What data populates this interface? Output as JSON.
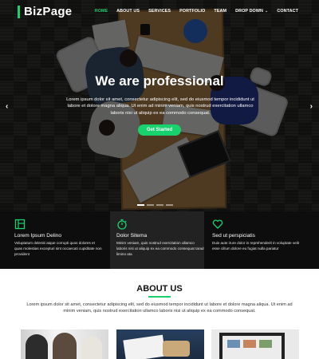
{
  "brand": "BizPage",
  "nav": [
    {
      "label": "HOME",
      "active": true
    },
    {
      "label": "ABOUT US"
    },
    {
      "label": "SERVICES"
    },
    {
      "label": "PORTFOLIO"
    },
    {
      "label": "TEAM"
    },
    {
      "label": "DROP DOWN"
    },
    {
      "label": "CONTACT"
    }
  ],
  "hero": {
    "title": "We are professional",
    "text": "Lorem ipsum dolor sit amet, consectetur adipiscing elit, sed do eiusmod tempor incididunt ut labore et dolore magna aliqua. Ut enim ad minim veniam, quis nostrud exercitation ullamco laboris nisi ut aliquip ex ea commodo consequat.",
    "button": "Get Started",
    "arrow_left": "‹",
    "arrow_right": "›",
    "slides": 4,
    "active_slide": 1
  },
  "features": [
    {
      "icon": "document-icon",
      "title": "Lorem Ipsum Delino",
      "text": "Voluptatum deleniti atque corrupti quos dolores et quas molestias excepturi sint occaecati cupiditate non provident"
    },
    {
      "icon": "stopwatch-icon",
      "title": "Dolor Sitema",
      "text": "Minim veniam, quis nostrud exercitation ullamco laboris nisi ut aliquip ex ea commodo consequat tarad limino ata"
    },
    {
      "icon": "heart-icon",
      "title": "Sed ut perspiciatis",
      "text": "Duis aute irure dolor in reprehenderit in voluptate velit esse cillum dolore eu fugiat nulla pariatur"
    }
  ],
  "about": {
    "title": "ABOUT US",
    "text": "Lorem ipsum dolor sit amet, consectetur adipiscing elit, sed do eiusmod tempor incididunt ut labore et dolore magna aliqua. Ut enim ad minim veniam, quis nostrud exercitation ullamco laboris nisi ut aliquip ex ea commodo consequat."
  },
  "colors": {
    "accent": "#18d26e",
    "dark": "#0d0d0d"
  }
}
